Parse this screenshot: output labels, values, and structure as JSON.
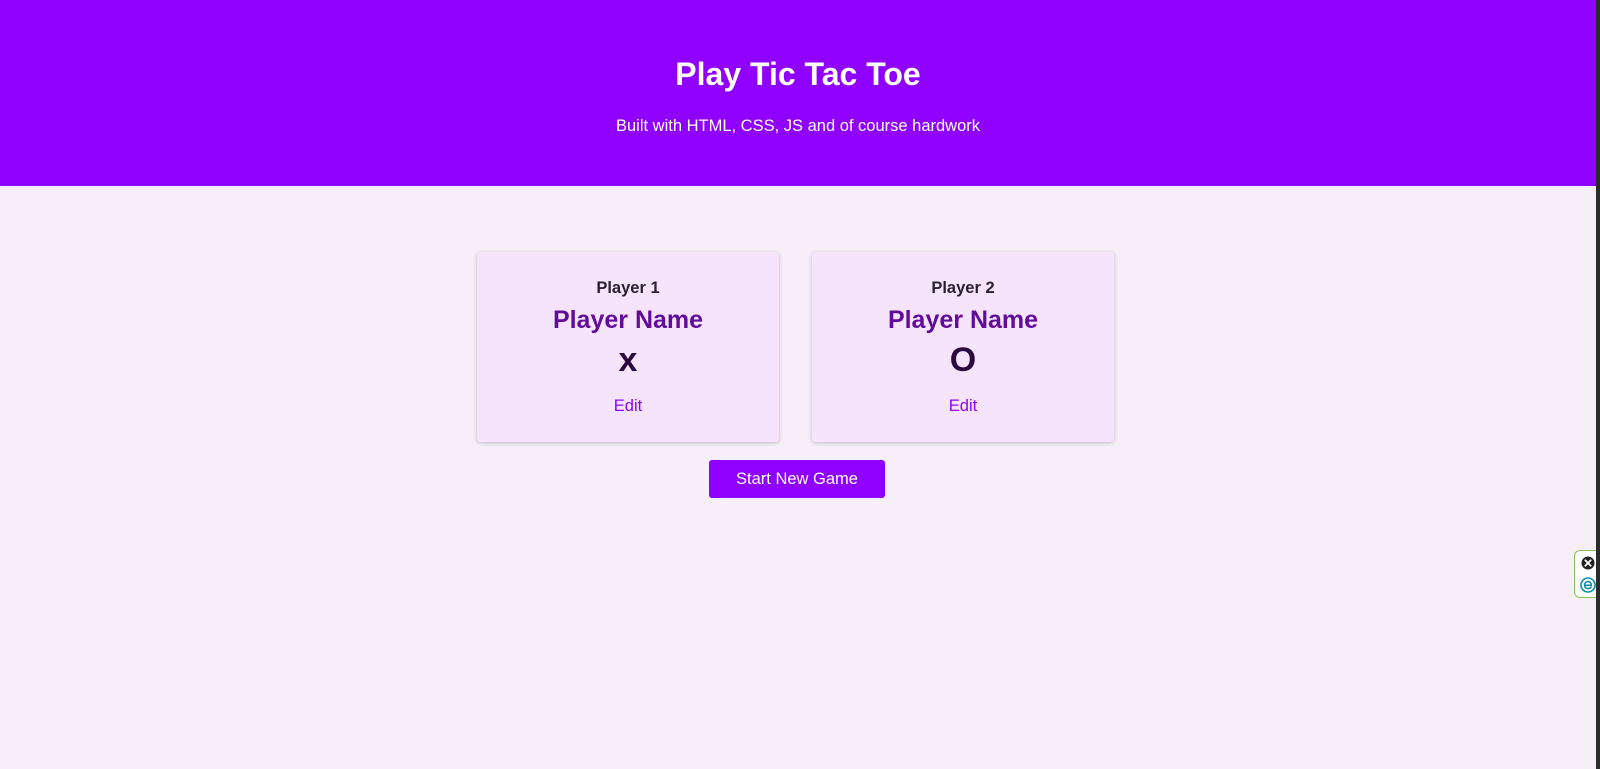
{
  "header": {
    "title": "Play Tic Tac Toe",
    "subtitle": "Built with HTML, CSS, JS and of course hardwork"
  },
  "players": [
    {
      "label": "Player 1",
      "name": "Player Name",
      "symbol": "x",
      "edit_label": "Edit"
    },
    {
      "label": "Player 2",
      "name": "Player Name",
      "symbol": "O",
      "edit_label": "Edit"
    }
  ],
  "start_button": {
    "label": "Start New Game"
  },
  "extension_widget": {
    "icons": [
      "close-icon",
      "e-icon"
    ]
  },
  "colors": {
    "accent": "#8f00ff",
    "background": "#f6eff8",
    "card_background": "#f5e4fc",
    "player_name": "#620d9a",
    "symbol": "#2b0840"
  }
}
